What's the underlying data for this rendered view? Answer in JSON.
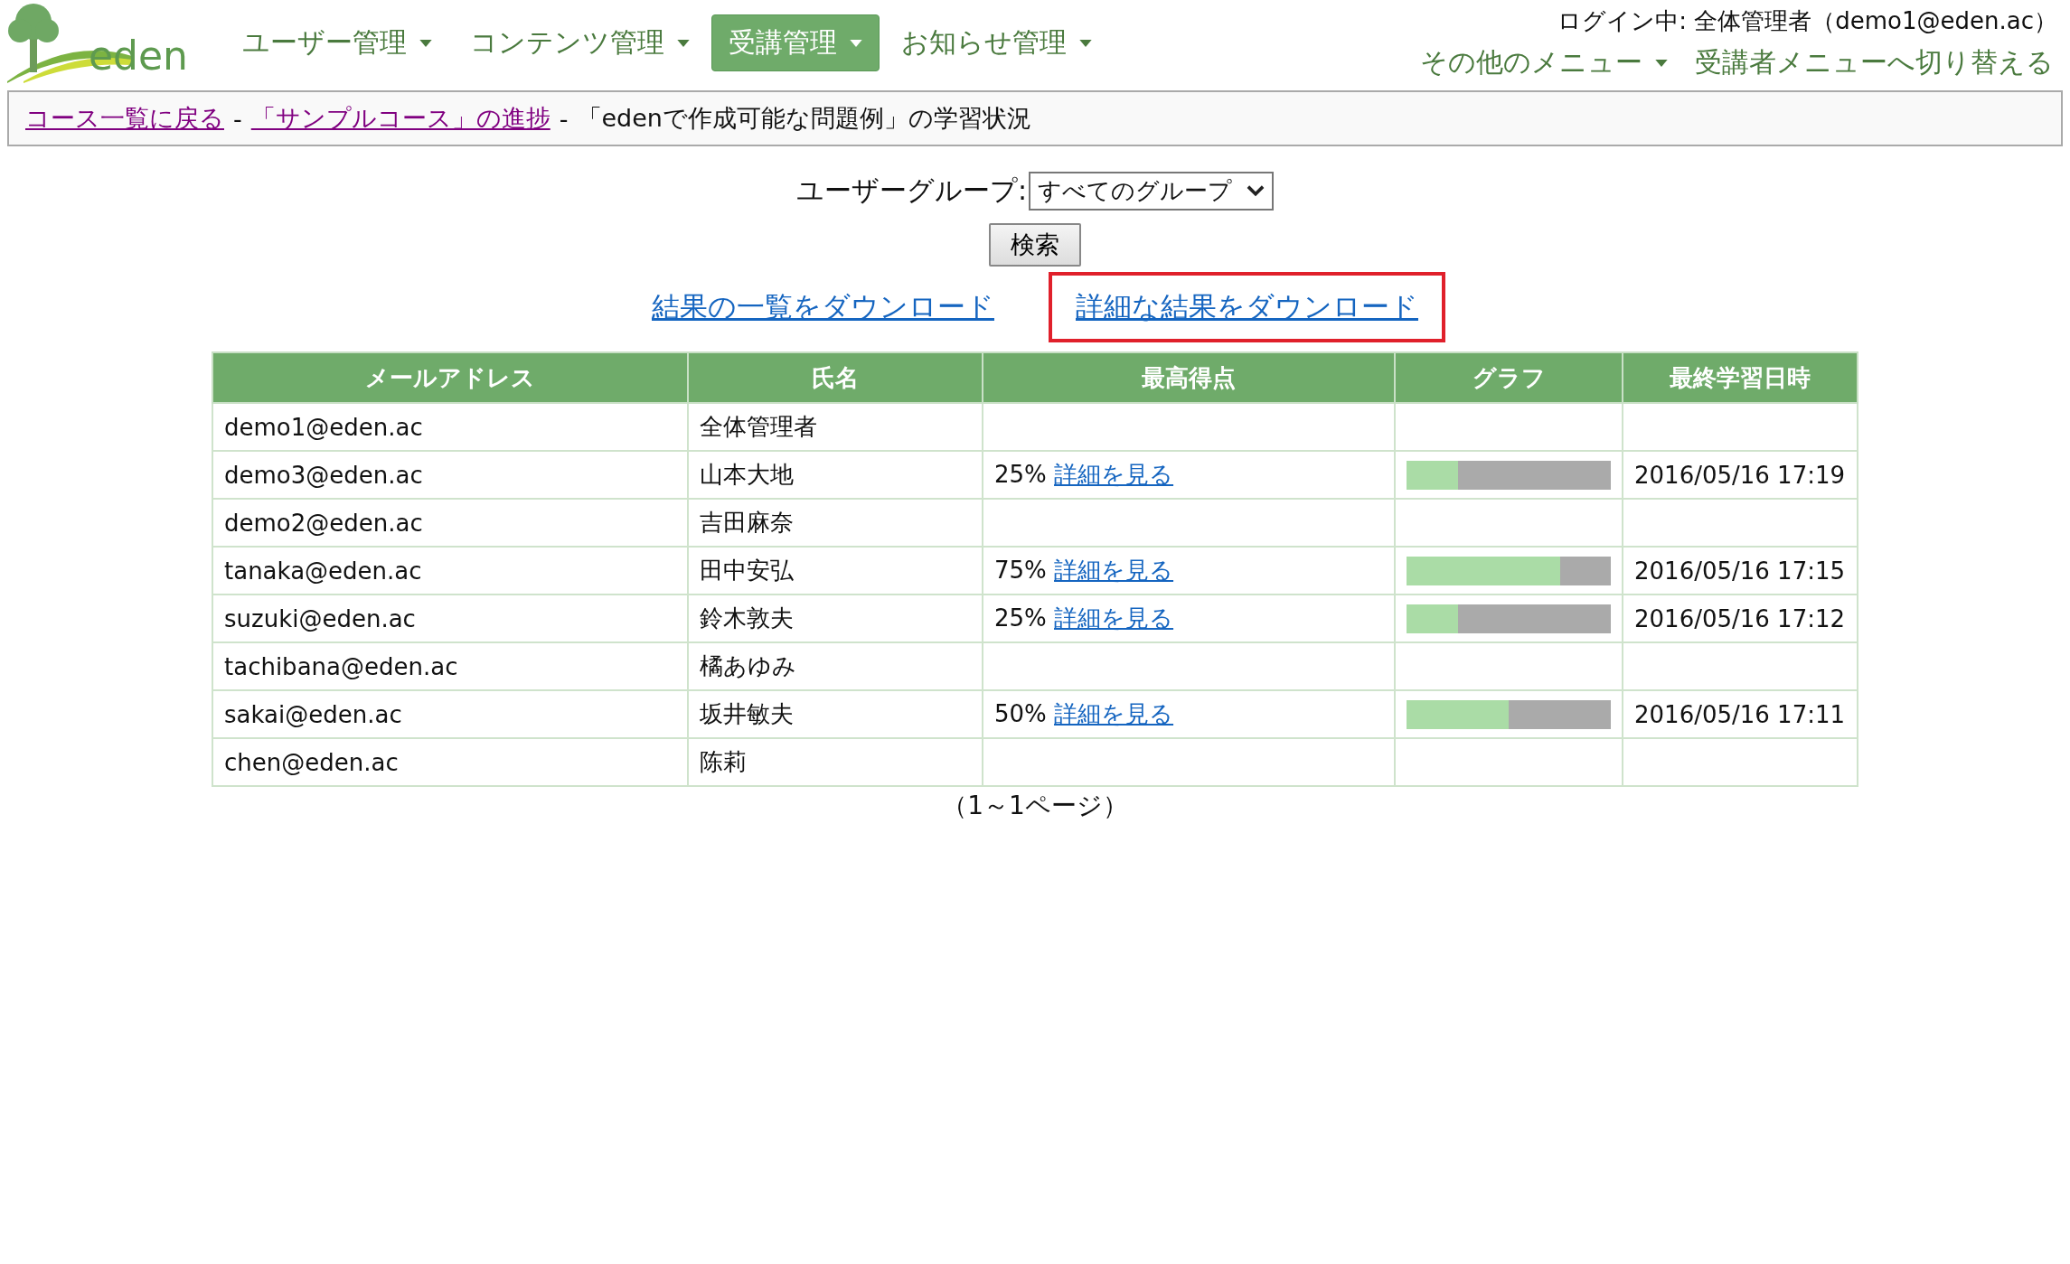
{
  "logo": {
    "text": "eden"
  },
  "nav": [
    {
      "label": "ユーザー管理",
      "selected": false
    },
    {
      "label": "コンテンツ管理",
      "selected": false
    },
    {
      "label": "受講管理",
      "selected": true
    },
    {
      "label": "お知らせ管理",
      "selected": false
    }
  ],
  "login_status": "ログイン中: 全体管理者（demo1@eden.ac）",
  "other_menu": "その他のメニュー",
  "switch_link": "受講者メニューへ切り替える",
  "breadcrumb": {
    "links": [
      "コース一覧に戻る",
      "「サンプルコース」の進捗"
    ],
    "separator": "-",
    "current": "「edenで作成可能な問題例」の学習状況"
  },
  "filter": {
    "label": "ユーザーグループ:",
    "value": "すべてのグループ"
  },
  "search_button": "検索",
  "download_links": [
    {
      "label": "結果の一覧をダウンロード",
      "highlighted": false
    },
    {
      "label": "詳細な結果をダウンロード",
      "highlighted": true
    }
  ],
  "table": {
    "columns": [
      "メールアドレス",
      "氏名",
      "最高得点",
      "グラフ",
      "最終学習日時"
    ],
    "rows": [
      {
        "email": "demo1@eden.ac",
        "name": "全体管理者"
      },
      {
        "email": "demo3@eden.ac",
        "name": "山本大地",
        "score": "25%",
        "detail": "詳細を見る",
        "level": 0.25,
        "date": "2016/05/16 17:19"
      },
      {
        "email": "demo2@eden.ac",
        "name": "吉田麻奈"
      },
      {
        "email": "tanaka@eden.ac",
        "name": "田中安弘",
        "score": "75%",
        "detail": "詳細を見る",
        "level": 0.75,
        "date": "2016/05/16 17:15"
      },
      {
        "email": "suzuki@eden.ac",
        "name": "鈴木敦夫",
        "score": "25%",
        "detail": "詳細を見る",
        "level": 0.25,
        "date": "2016/05/16 17:12"
      },
      {
        "email": "tachibana@eden.ac",
        "name": "橘あゆみ"
      },
      {
        "email": "sakai@eden.ac",
        "name": "坂井敏夫",
        "score": "50%",
        "detail": "詳細を見る",
        "level": 0.5,
        "date": "2016/05/16 17:11"
      },
      {
        "email": "chen@eden.ac",
        "name": "陈莉"
      }
    ]
  },
  "pagination": "（1～1ページ）"
}
